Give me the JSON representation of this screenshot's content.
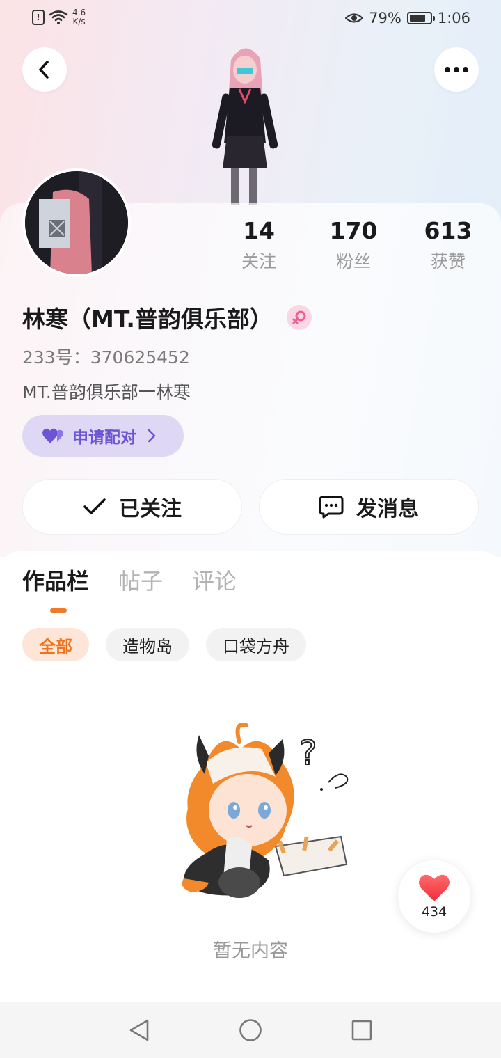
{
  "status_bar": {
    "net_speed_value": "4.6",
    "net_speed_unit": "K/s",
    "battery_percent": "79%",
    "battery_level": 0.79,
    "time": "1:06"
  },
  "profile": {
    "username": "林寒（MT.普韵俱乐部）",
    "gender_icon": "female-icon",
    "uid": "233号：370625452",
    "bio": "MT.普韵俱乐部一林寒",
    "pair_button_label": "申请配对"
  },
  "stats": [
    {
      "value": "14",
      "label": "关注"
    },
    {
      "value": "170",
      "label": "粉丝"
    },
    {
      "value": "613",
      "label": "获赞"
    }
  ],
  "actions": {
    "follow_label": "已关注",
    "message_label": "发消息"
  },
  "tabs": [
    "作品栏",
    "帖子",
    "评论"
  ],
  "filters": [
    "全部",
    "造物岛",
    "口袋方舟"
  ],
  "empty_state": {
    "text": "暂无内容"
  },
  "like_float": {
    "count": "434"
  },
  "colors": {
    "accent_orange": "#f07a28",
    "pair_purple": "#6a55d4",
    "gender_pink": "#f25c8e"
  }
}
